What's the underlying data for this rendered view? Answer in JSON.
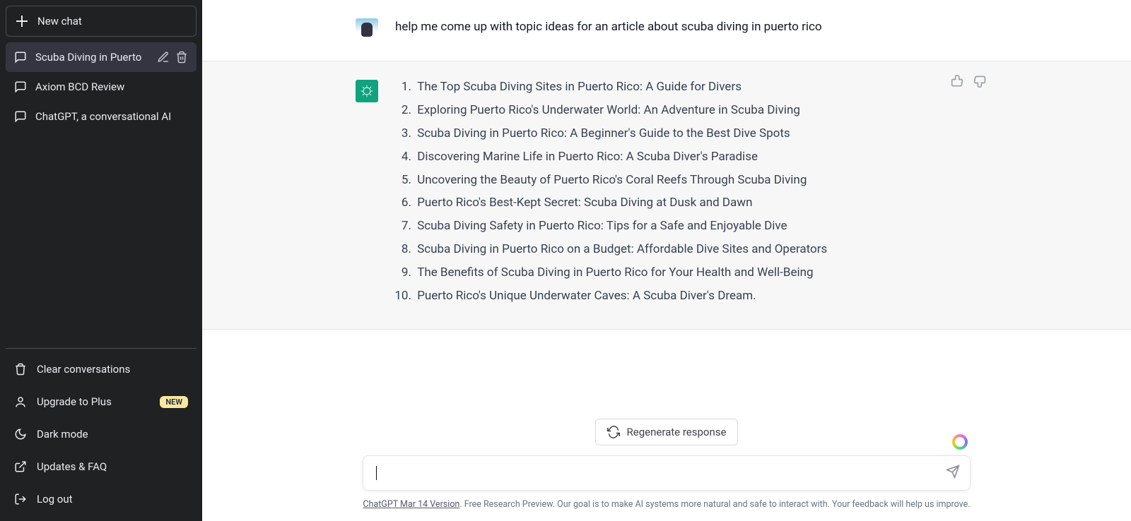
{
  "sidebar": {
    "new_chat_label": "New chat",
    "chats": [
      {
        "title": "Scuba Diving in Puerto",
        "active": true
      },
      {
        "title": "Axiom BCD Review",
        "active": false
      },
      {
        "title": "ChatGPT, a conversational AI",
        "active": false
      }
    ],
    "clear_label": "Clear conversations",
    "upgrade_label": "Upgrade to Plus",
    "upgrade_badge": "NEW",
    "dark_mode_label": "Dark mode",
    "updates_label": "Updates & FAQ",
    "logout_label": "Log out"
  },
  "conversation": {
    "user_message": "help me come up with topic ideas for an article about scuba diving in puerto rico",
    "assistant_list": [
      "The Top Scuba Diving Sites in Puerto Rico: A Guide for Divers",
      "Exploring Puerto Rico's Underwater World: An Adventure in Scuba Diving",
      "Scuba Diving in Puerto Rico: A Beginner's Guide to the Best Dive Spots",
      "Discovering Marine Life in Puerto Rico: A Scuba Diver's Paradise",
      "Uncovering the Beauty of Puerto Rico's Coral Reefs Through Scuba Diving",
      "Puerto Rico's Best-Kept Secret: Scuba Diving at Dusk and Dawn",
      "Scuba Diving Safety in Puerto Rico: Tips for a Safe and Enjoyable Dive",
      "Scuba Diving in Puerto Rico on a Budget: Affordable Dive Sites and Operators",
      "The Benefits of Scuba Diving in Puerto Rico for Your Health and Well-Being",
      "Puerto Rico's Unique Underwater Caves: A Scuba Diver's Dream."
    ]
  },
  "bottom": {
    "regenerate_label": "Regenerate response",
    "input_placeholder": "",
    "footer_version": "ChatGPT Mar 14 Version",
    "footer_rest": ". Free Research Preview. Our goal is to make AI systems more natural and safe to interact with. Your feedback will help us improve."
  }
}
